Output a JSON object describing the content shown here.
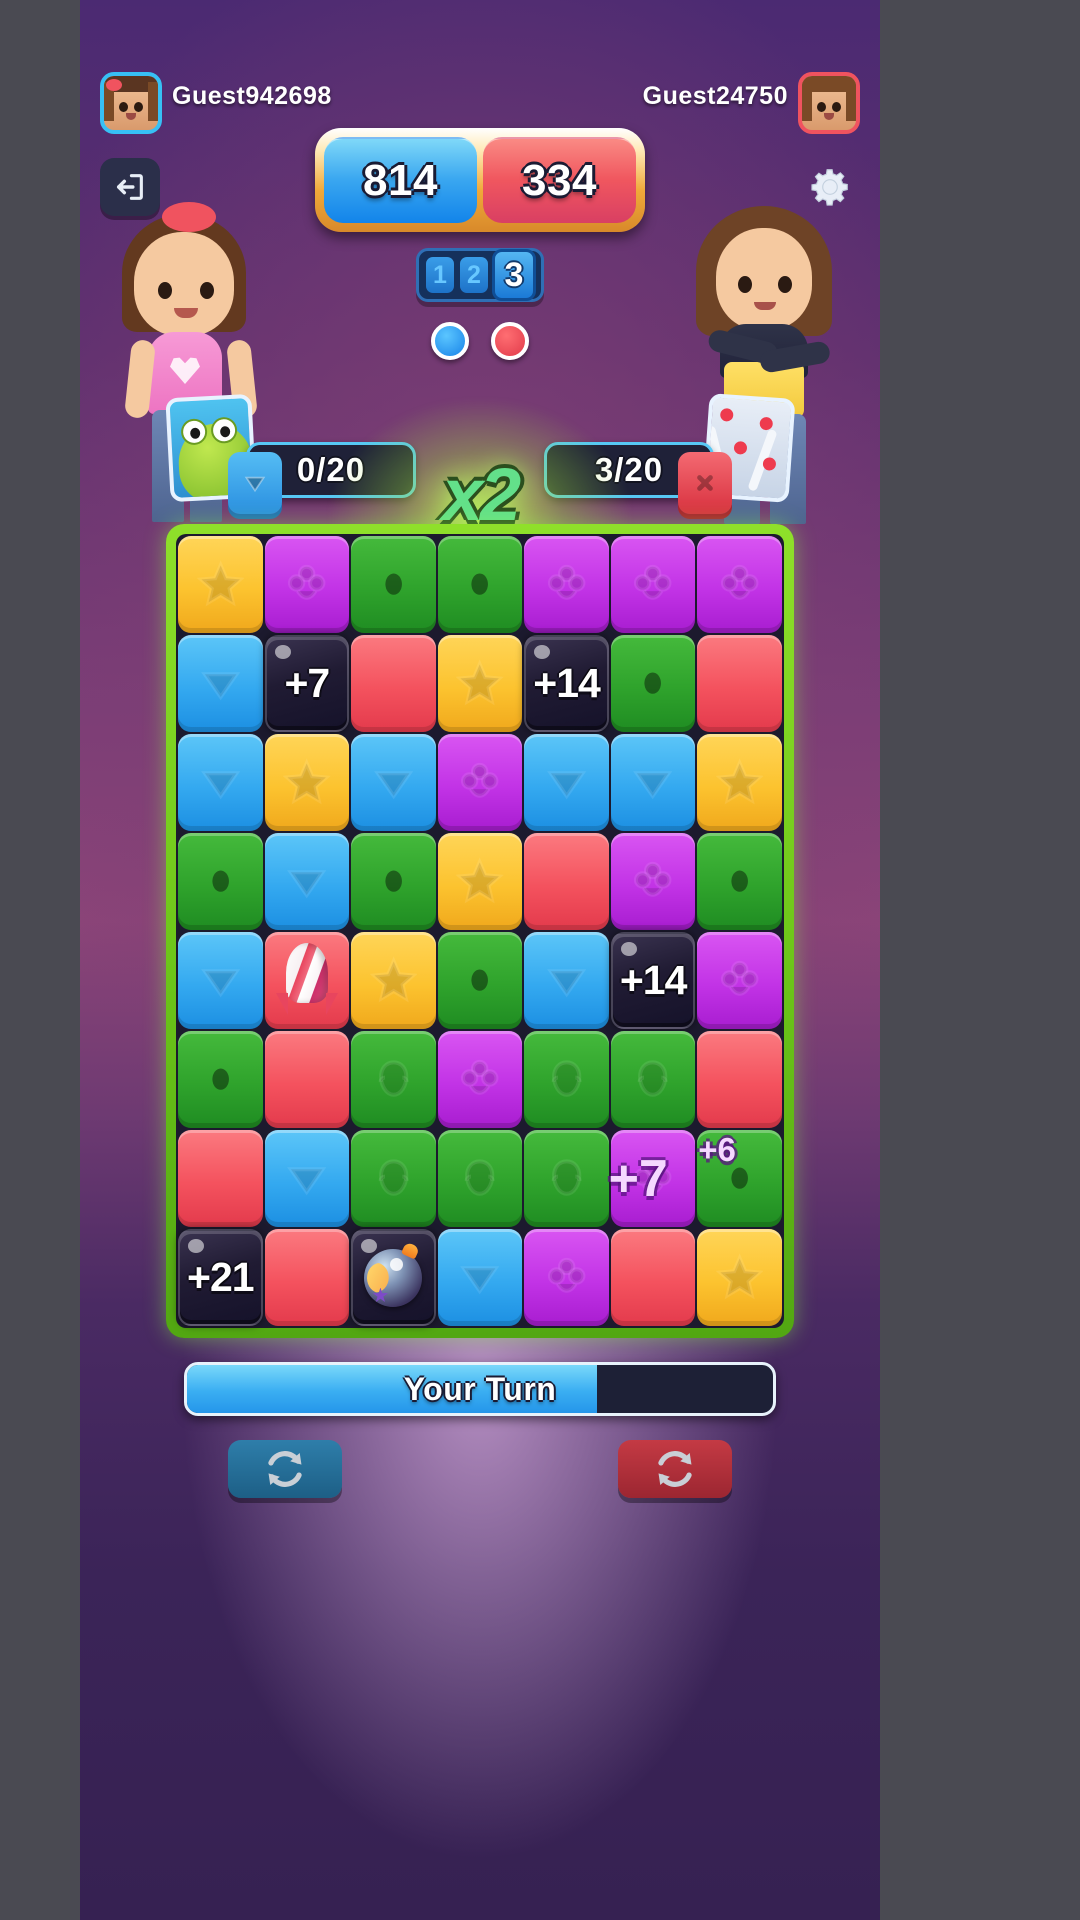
{
  "header": {
    "player_left": {
      "name": "Guest942698",
      "score": "814",
      "color": "#2a96e8"
    },
    "player_right": {
      "name": "Guest24750",
      "score": "334",
      "color": "#e8445c"
    },
    "exit_button": "exit-icon",
    "settings_button": "gear-icon"
  },
  "moves": {
    "pips": [
      "1",
      "2"
    ],
    "active": "3"
  },
  "turn_indicator": {
    "left_dot": "#1883e8",
    "right_dot": "#e13a4a"
  },
  "goals": {
    "left": {
      "progress": "0/20",
      "card": "frog-card",
      "tile": "blue-triangle"
    },
    "right": {
      "progress": "3/20",
      "card": "candy-card",
      "tile": "red-cross"
    }
  },
  "multiplier": "x2",
  "turn_bar": {
    "label": "Your Turn",
    "fill_percent": 70
  },
  "buttons": {
    "refresh_left": "refresh-icon",
    "refresh_right": "refresh-icon"
  },
  "chart_data": {
    "type": "table",
    "title": "Match-2 puzzle board 7x8",
    "columns": 7,
    "rows": 8,
    "legend": {
      "blue": "triangle",
      "red": "cross",
      "green": "circle",
      "yellow": "star",
      "purple": "clover",
      "dark": "bonus-points"
    },
    "board": [
      [
        {
          "c": "yellow",
          "g": "star"
        },
        {
          "c": "purple",
          "g": "clover"
        },
        {
          "c": "green",
          "g": "circle"
        },
        {
          "c": "green",
          "g": "circle"
        },
        {
          "c": "purple",
          "g": "clover"
        },
        {
          "c": "purple",
          "g": "clover"
        },
        {
          "c": "purple",
          "g": "clover"
        }
      ],
      [
        {
          "c": "blue",
          "g": "triangle"
        },
        {
          "c": "dark",
          "g": "",
          "n": "+7"
        },
        {
          "c": "red",
          "g": "cross"
        },
        {
          "c": "yellow",
          "g": "star"
        },
        {
          "c": "dark",
          "g": "",
          "n": "+14"
        },
        {
          "c": "green",
          "g": "circle"
        },
        {
          "c": "red",
          "g": "cross"
        }
      ],
      [
        {
          "c": "blue",
          "g": "triangle"
        },
        {
          "c": "yellow",
          "g": "star"
        },
        {
          "c": "blue",
          "g": "triangle"
        },
        {
          "c": "purple",
          "g": "clover"
        },
        {
          "c": "blue",
          "g": "triangle"
        },
        {
          "c": "blue",
          "g": "triangle"
        },
        {
          "c": "yellow",
          "g": "star"
        }
      ],
      [
        {
          "c": "green",
          "g": "circle"
        },
        {
          "c": "blue",
          "g": "triangle"
        },
        {
          "c": "green",
          "g": "circle"
        },
        {
          "c": "yellow",
          "g": "star"
        },
        {
          "c": "red",
          "g": "cross"
        },
        {
          "c": "purple",
          "g": "clover"
        },
        {
          "c": "green",
          "g": "circle"
        }
      ],
      [
        {
          "c": "blue",
          "g": "triangle"
        },
        {
          "c": "red",
          "g": "rocket"
        },
        {
          "c": "yellow",
          "g": "star"
        },
        {
          "c": "green",
          "g": "circle"
        },
        {
          "c": "blue",
          "g": "triangle"
        },
        {
          "c": "dark",
          "g": "",
          "n": "+14"
        },
        {
          "c": "purple",
          "g": "clover"
        }
      ],
      [
        {
          "c": "green",
          "g": "circle"
        },
        {
          "c": "red",
          "g": "cross"
        },
        {
          "c": "green",
          "g": "frog"
        },
        {
          "c": "purple",
          "g": "clover"
        },
        {
          "c": "green",
          "g": "frog"
        },
        {
          "c": "green",
          "g": "frog"
        },
        {
          "c": "red",
          "g": "cross"
        }
      ],
      [
        {
          "c": "red",
          "g": "cross"
        },
        {
          "c": "blue",
          "g": "triangle"
        },
        {
          "c": "green",
          "g": "frog"
        },
        {
          "c": "green",
          "g": "frog"
        },
        {
          "c": "green",
          "g": "frog"
        },
        {
          "c": "purple",
          "g": "clover"
        },
        {
          "c": "green",
          "g": "circle"
        }
      ],
      [
        {
          "c": "dark",
          "g": "",
          "n": "+21"
        },
        {
          "c": "red",
          "g": "cross"
        },
        {
          "c": "dark",
          "g": "bomb"
        },
        {
          "c": "blue",
          "g": "triangle"
        },
        {
          "c": "purple",
          "g": "clover"
        },
        {
          "c": "red",
          "g": "cross"
        },
        {
          "c": "yellow",
          "g": "star"
        }
      ]
    ],
    "floating_labels": [
      {
        "text": "+7",
        "row": 6,
        "col": 5
      },
      {
        "text": "+6",
        "row": 6,
        "col": 6
      }
    ]
  }
}
